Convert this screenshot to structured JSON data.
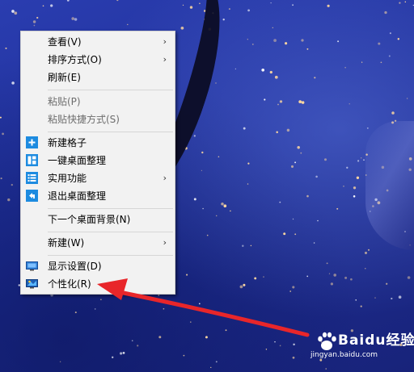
{
  "context_menu": {
    "items": [
      {
        "label": "查看(V)",
        "submenu": true
      },
      {
        "label": "排序方式(O)",
        "submenu": true
      },
      {
        "label": "刷新(E)"
      },
      {
        "label": "粘贴(P)",
        "disabled": true
      },
      {
        "label": "粘贴快捷方式(S)",
        "disabled": true
      },
      {
        "label": "新建格子",
        "icon": "plus-icon"
      },
      {
        "label": "一键桌面整理",
        "icon": "layout-grid-icon"
      },
      {
        "label": "实用功能",
        "icon": "list-icon",
        "submenu": true
      },
      {
        "label": "退出桌面整理",
        "icon": "exit-icon"
      },
      {
        "label": "下一个桌面背景(N)"
      },
      {
        "label": "新建(W)",
        "submenu": true
      },
      {
        "label": "显示设置(D)",
        "icon": "display-settings-icon"
      },
      {
        "label": "个性化(R)",
        "icon": "personalize-icon"
      }
    ],
    "submenu_glyph": "›"
  },
  "watermark": {
    "brand": "Baidu经验",
    "url": "jingyan.baidu.com"
  },
  "colors": {
    "desktop_blue": "#1f2f98",
    "menu_bg": "#f2f2f2",
    "icon_blue": "#1d8be0",
    "arrow_red": "#e8262a"
  }
}
